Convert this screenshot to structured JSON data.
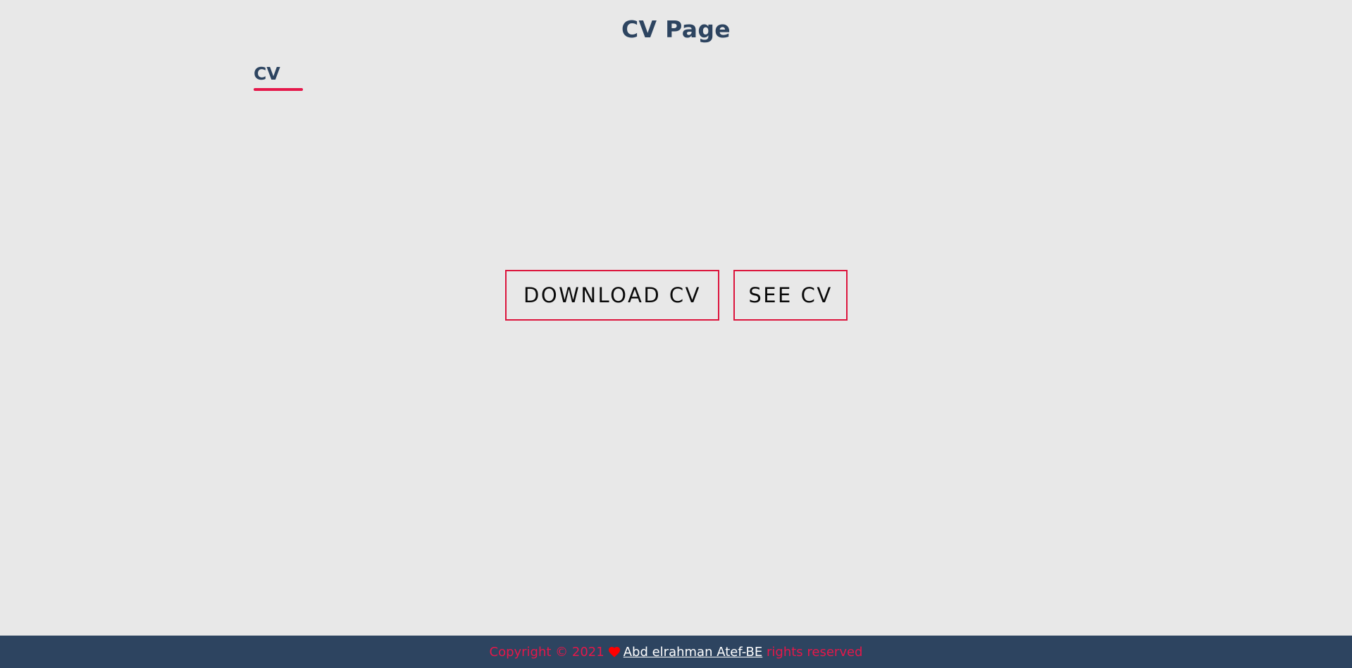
{
  "header": {
    "title": "CV Page"
  },
  "section": {
    "heading": "CV"
  },
  "actions": {
    "download_label": "DOWNLOAD CV",
    "see_label": "SEE CV"
  },
  "footer": {
    "copyright_prefix": "Copyright © 2021",
    "heart_icon": "heart-icon",
    "author_link": "Abd elrahman Atef-BE",
    "suffix": " rights reserved"
  },
  "colors": {
    "background": "#e8e8e8",
    "heading": "#2d4460",
    "accent": "#e5174a",
    "button_border": "#dc143c",
    "footer_bg": "#2d4460",
    "footer_link": "#ffffff",
    "heart": "#ff0000"
  }
}
